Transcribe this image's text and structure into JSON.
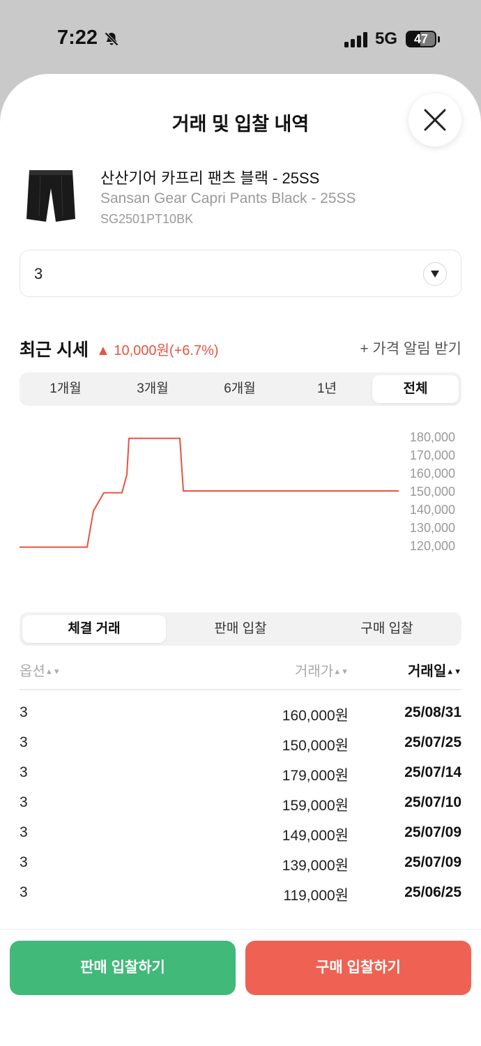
{
  "status_bar": {
    "time": "7:22",
    "network": "5G",
    "battery_level": "47"
  },
  "sheet": {
    "title": "거래 및 입찰 내역"
  },
  "product": {
    "name_ko": "산산기어 카프리 팬츠 블랙 - 25SS",
    "name_en": "Sansan Gear Capri Pants Black - 25SS",
    "code": "SG2501PT10BK"
  },
  "size_select": {
    "value": "3"
  },
  "market": {
    "title": "최근 시세",
    "change_arrow": "▲",
    "change": "10,000원(+6.7%)",
    "alert_link": "+ 가격 알림 받기"
  },
  "period_tabs": [
    {
      "label": "1개월",
      "active": false
    },
    {
      "label": "3개월",
      "active": false
    },
    {
      "label": "6개월",
      "active": false
    },
    {
      "label": "1년",
      "active": false
    },
    {
      "label": "전체",
      "active": true
    }
  ],
  "chart_data": {
    "type": "line",
    "series": [
      {
        "values": [
          119000,
          119000,
          139000,
          149000,
          149000,
          159000,
          179000,
          179000,
          179000,
          150000,
          150000,
          150000
        ]
      }
    ],
    "y_ticks": [
      "180,000",
      "170,000",
      "160,000",
      "150,000",
      "140,000",
      "130,000",
      "120,000"
    ],
    "ylim": [
      120000,
      180000
    ],
    "line_color": "#e7533f"
  },
  "trade_tabs": [
    {
      "label": "체결 거래",
      "active": true
    },
    {
      "label": "판매 입찰",
      "active": false
    },
    {
      "label": "구매 입찰",
      "active": false
    }
  ],
  "table": {
    "headers": {
      "option": "옵션",
      "price": "거래가",
      "date": "거래일"
    },
    "rows": [
      {
        "option": "3",
        "price": "160,000원",
        "date": "25/08/31"
      },
      {
        "option": "3",
        "price": "150,000원",
        "date": "25/07/25"
      },
      {
        "option": "3",
        "price": "179,000원",
        "date": "25/07/14"
      },
      {
        "option": "3",
        "price": "159,000원",
        "date": "25/07/10"
      },
      {
        "option": "3",
        "price": "149,000원",
        "date": "25/07/09"
      },
      {
        "option": "3",
        "price": "139,000원",
        "date": "25/07/09"
      },
      {
        "option": "3",
        "price": "119,000원",
        "date": "25/06/25"
      }
    ]
  },
  "actions": {
    "sell_label": "판매 입찰하기",
    "buy_label": "구매 입찰하기",
    "sell_color": "#41b979",
    "buy_color": "#ef6253"
  }
}
